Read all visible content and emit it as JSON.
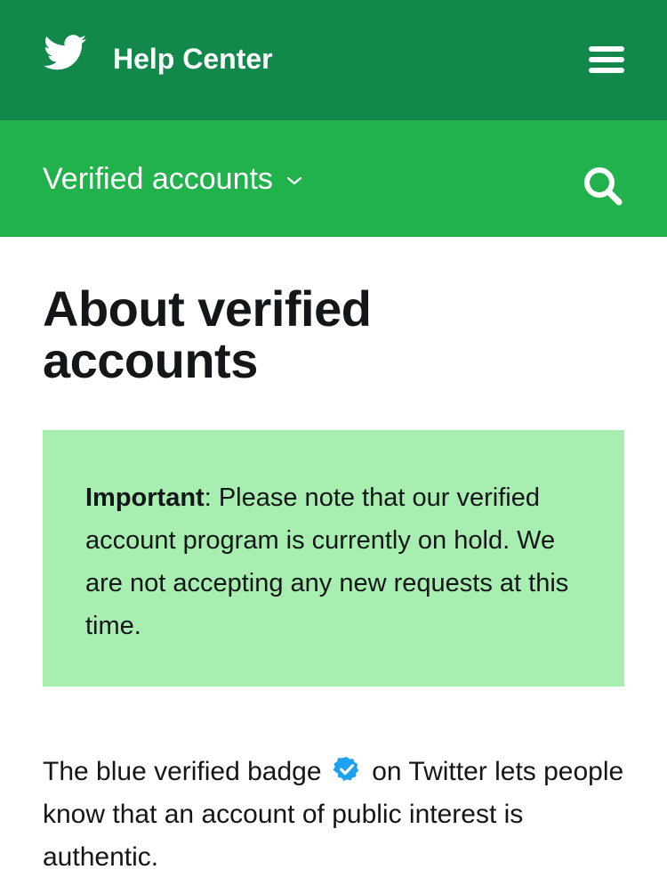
{
  "header": {
    "brand": "Help Center",
    "logo_icon": "twitter-bird-icon",
    "menu_icon": "hamburger-menu-icon",
    "background": "#12894a"
  },
  "subheader": {
    "section": "Verified accounts",
    "dropdown_icon": "chevron-down-icon",
    "search_icon": "search-icon",
    "background": "#22b24c"
  },
  "article": {
    "title": "About verified accounts",
    "notice": {
      "label": "Important",
      "text": ": Please note that our verified account program is currently on hold. We are not accepting any new requests at this time.",
      "background": "#a8eeb0"
    },
    "paragraph": {
      "before_badge": "The blue verified badge",
      "badge_icon": "verified-badge-icon",
      "after_badge": "on Twitter lets people know that an account of public interest is authentic."
    }
  }
}
